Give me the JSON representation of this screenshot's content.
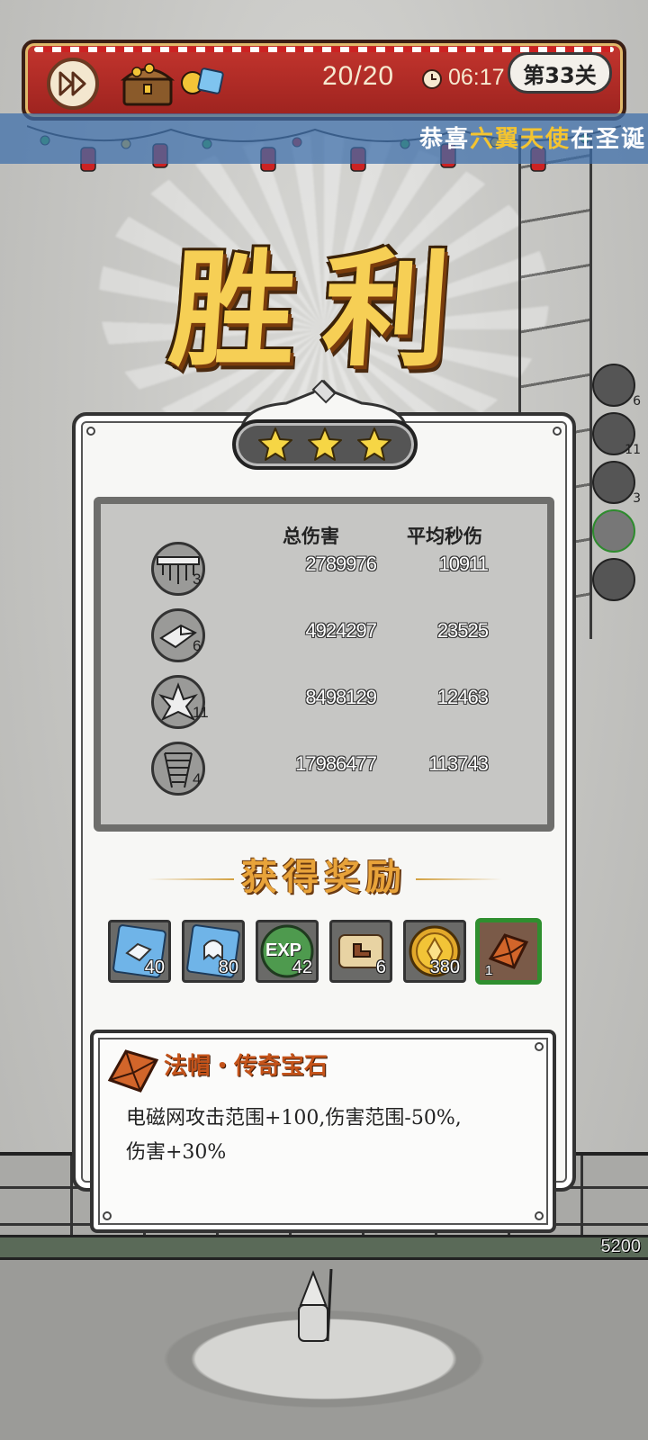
{
  "hud": {
    "wave": "20/20",
    "time": "06:17",
    "level": "第33关"
  },
  "banner": {
    "prefix": "恭喜",
    "player": "六翼天使",
    "suffix": "在圣诞"
  },
  "victory_title": "胜利",
  "stars": 3,
  "stats": {
    "header_total": "总伤害",
    "header_dps": "平均秒伤",
    "rows": [
      {
        "level": "3",
        "total": "2789976",
        "dps": "10911",
        "icon": "spike-trap-icon"
      },
      {
        "level": "6",
        "total": "4924297",
        "dps": "23525",
        "icon": "crystal-block-icon"
      },
      {
        "level": "11",
        "total": "8498129",
        "dps": "12463",
        "icon": "ice-shard-icon"
      },
      {
        "level": "4",
        "total": "17986477",
        "dps": "113743",
        "icon": "tornado-icon"
      }
    ]
  },
  "rewards": {
    "title": "获得奖励",
    "items": [
      {
        "icon": "ice-gem-icon",
        "count": "40"
      },
      {
        "icon": "ghost-gem-icon",
        "count": "80"
      },
      {
        "icon": "exp-icon",
        "count": "42",
        "label": "EXP"
      },
      {
        "icon": "boot-scroll-icon",
        "count": "6"
      },
      {
        "icon": "gold-coin-icon",
        "count": "380"
      },
      {
        "icon": "legend-gem-icon",
        "count": "1"
      }
    ]
  },
  "detail": {
    "title": "法帽・传奇宝石",
    "line1": "电磁网攻击范围+100,伤害范围-50%,",
    "line2": "伤害+30%"
  },
  "base_hp": "5200",
  "skill_levels": [
    "6",
    "11",
    "3"
  ],
  "colors": {
    "victory_gold": "#f6cf55",
    "reward_orange": "#e8a33a",
    "gem_orange": "#c4531a",
    "banner_blue": "#3c6eaa",
    "selected_green": "#2f8f2f"
  }
}
